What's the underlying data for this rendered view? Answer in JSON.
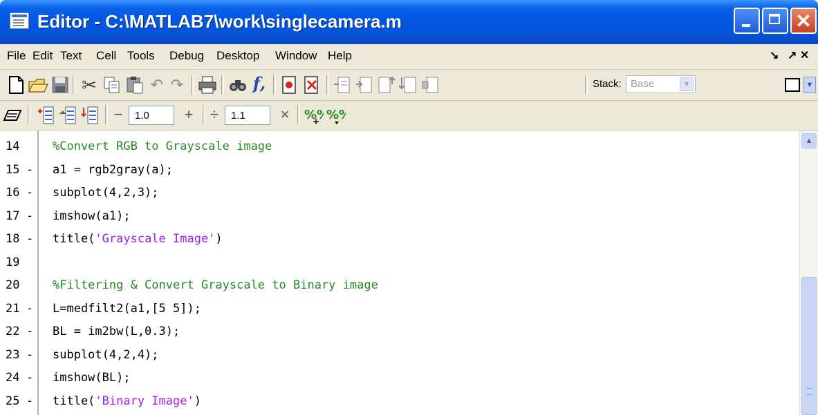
{
  "window": {
    "title": "Editor - C:\\MATLAB7\\work\\singlecamera.m",
    "close_glyph": "✕"
  },
  "menu": {
    "items": [
      "File",
      "Edit",
      "Text",
      "Cell",
      "Tools",
      "Debug",
      "Desktop",
      "Window",
      "Help"
    ],
    "right_controls": [
      "↘",
      "↗ ✕"
    ]
  },
  "toolbar": {
    "icons": [
      "new-file-icon",
      "open-folder-icon",
      "save-icon",
      "cut-icon",
      "copy-icon",
      "paste-icon",
      "undo-icon",
      "redo-icon",
      "print-icon",
      "find-icon",
      "function-icon",
      "set-breakpoint-icon",
      "clear-breakpoint-icon",
      "step-icon",
      "step-in-icon",
      "step-out-icon",
      "continue-icon",
      "exit-debug-icon"
    ],
    "stack_label": "Stack:",
    "stack_value": "Base"
  },
  "cell_toolbar": {
    "decrement_value": "1.0",
    "divide_value": "1.1",
    "minus_label": "−",
    "plus_label": "+",
    "divide_label": "÷",
    "times_label": "×"
  },
  "editor": {
    "lines": [
      {
        "num": "14",
        "bp": "",
        "segments": [
          {
            "t": "%Convert RGB to Grayscale image",
            "c": "comment"
          }
        ]
      },
      {
        "num": "15",
        "bp": "-",
        "segments": [
          {
            "t": "a1 = rgb2gray(a);",
            "c": ""
          }
        ]
      },
      {
        "num": "16",
        "bp": "-",
        "segments": [
          {
            "t": "subplot(4,2,3);",
            "c": ""
          }
        ]
      },
      {
        "num": "17",
        "bp": "-",
        "segments": [
          {
            "t": "imshow(a1);",
            "c": ""
          }
        ]
      },
      {
        "num": "18",
        "bp": "-",
        "segments": [
          {
            "t": "title(",
            "c": ""
          },
          {
            "t": "'Grayscale Image'",
            "c": "str"
          },
          {
            "t": ")",
            "c": ""
          }
        ]
      },
      {
        "num": "19",
        "bp": "",
        "segments": []
      },
      {
        "num": "20",
        "bp": "",
        "segments": [
          {
            "t": "%Filtering & Convert Grayscale to Binary image",
            "c": "comment"
          }
        ]
      },
      {
        "num": "21",
        "bp": "-",
        "segments": [
          {
            "t": "L=medfilt2(a1,[5 5]);",
            "c": ""
          }
        ]
      },
      {
        "num": "22",
        "bp": "-",
        "segments": [
          {
            "t": "BL = im2bw(L,0.3);",
            "c": ""
          }
        ]
      },
      {
        "num": "23",
        "bp": "-",
        "segments": [
          {
            "t": "subplot(4,2,4);",
            "c": ""
          }
        ]
      },
      {
        "num": "24",
        "bp": "-",
        "segments": [
          {
            "t": "imshow(BL);",
            "c": ""
          }
        ]
      },
      {
        "num": "25",
        "bp": "-",
        "segments": [
          {
            "t": "title(",
            "c": ""
          },
          {
            "t": "'Binary Image'",
            "c": "str"
          },
          {
            "t": ")",
            "c": ""
          }
        ]
      }
    ]
  },
  "colors": {
    "comment": "#228B22",
    "string": "#A020F0",
    "titlebar": "#0058E6"
  }
}
